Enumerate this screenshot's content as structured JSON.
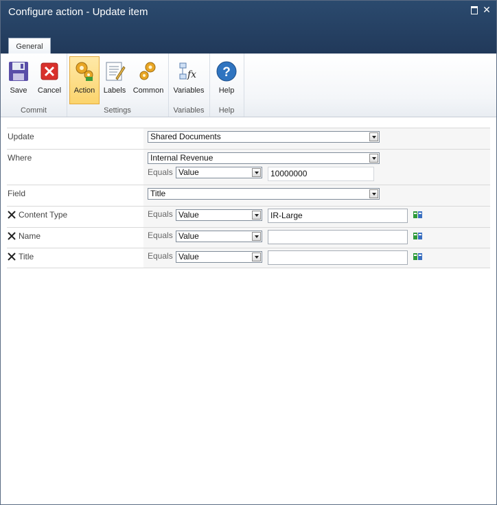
{
  "window": {
    "title": "Configure action - Update item"
  },
  "tabs": [
    "General"
  ],
  "ribbon": {
    "groups": {
      "commit": "Commit",
      "settings": "Settings",
      "variables": "Variables",
      "help": "Help"
    },
    "buttons": {
      "save": "Save",
      "cancel": "Cancel",
      "action": "Action",
      "labels": "Labels",
      "common": "Common",
      "variables": "Variables",
      "help": "Help"
    }
  },
  "form": {
    "update": {
      "label": "Update",
      "list": "Shared Documents"
    },
    "where": {
      "label": "Where",
      "column": "Internal Revenue",
      "operator": "Equals",
      "type": "Value",
      "value": "10000000"
    },
    "field": {
      "label": "Field",
      "value": "Title"
    },
    "rows": [
      {
        "label": "Content Type",
        "operator": "Equals",
        "type": "Value",
        "value": "IR-Large"
      },
      {
        "label": "Name",
        "operator": "Equals",
        "type": "Value",
        "value": ""
      },
      {
        "label": "Title",
        "operator": "Equals",
        "type": "Value",
        "value": ""
      }
    ]
  }
}
